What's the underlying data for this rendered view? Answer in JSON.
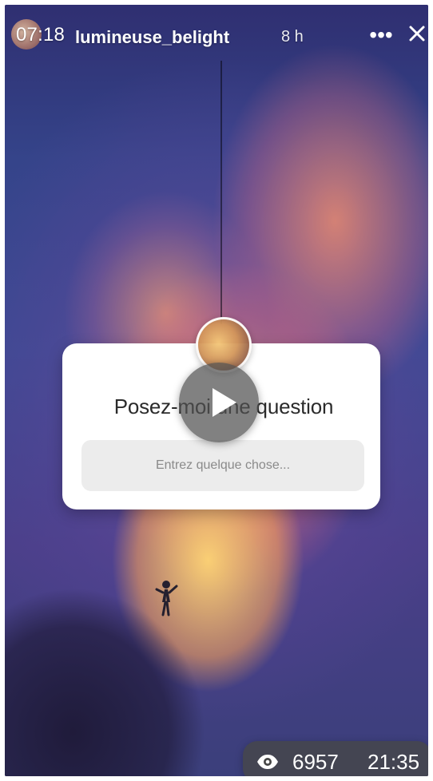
{
  "header": {
    "time": "07:18",
    "username": "lumineuse_belight",
    "age": "8 h",
    "more_icon": "more-horizontal-icon",
    "close_icon": "close-icon"
  },
  "sticker": {
    "question": "Posez-moi une question",
    "input_placeholder": "Entrez quelque chose...",
    "avatar_icon": "profile-avatar"
  },
  "overlay": {
    "play_icon": "play-icon"
  },
  "footer": {
    "eye_icon": "eye-icon",
    "views": "6957",
    "duration": "21:35"
  },
  "colors": {
    "sky_primary": "#364487",
    "sticker_bg": "#ffffff",
    "input_bg": "#ececec",
    "pill_bg": "#464646"
  }
}
